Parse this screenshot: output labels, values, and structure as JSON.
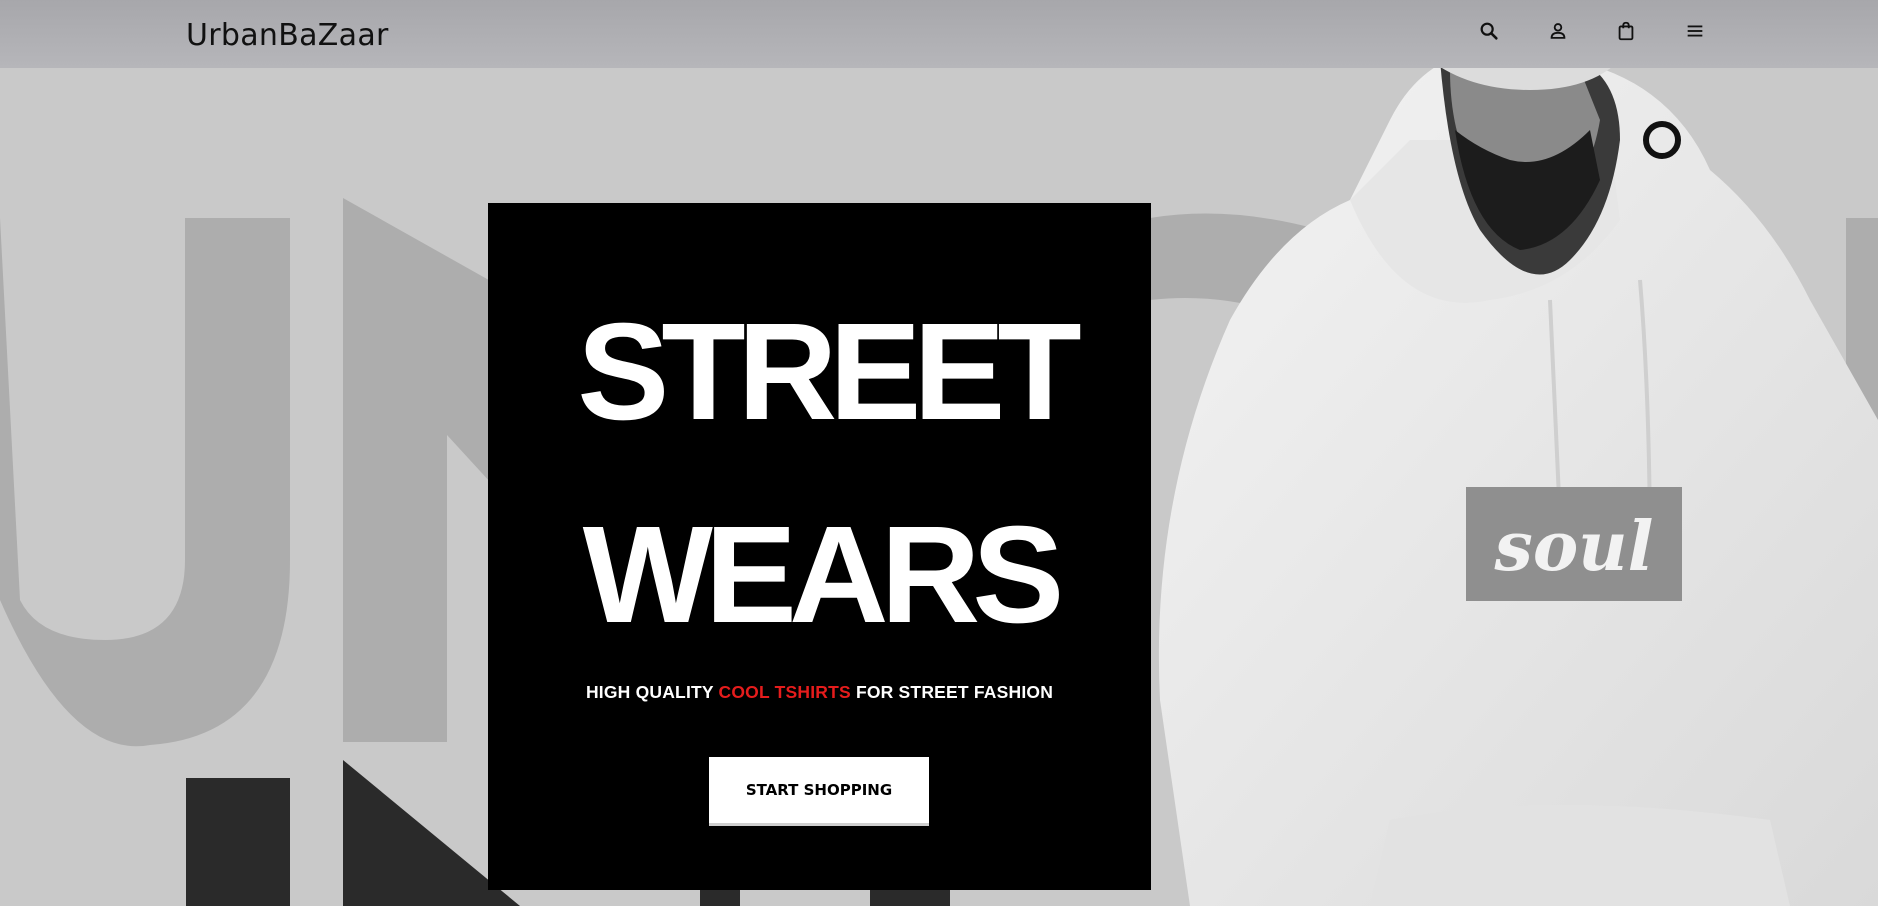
{
  "header": {
    "logo": "UrbanBaZaar",
    "icons": [
      "search-icon",
      "user-icon",
      "shopping-bag-icon",
      "menu-icon"
    ]
  },
  "hero": {
    "line1": "STREET",
    "line2": "WEARS",
    "tagline_pre": "HIGH QUALITY ",
    "tagline_accent": "COOL TSHIRTS",
    "tagline_post": " FOR STREET FASHION",
    "cta_label": "START SHOPPING",
    "accent_color": "#e51c1c"
  },
  "photo": {
    "hoodie_print": "soul"
  },
  "background": {
    "letters": "UNION"
  }
}
